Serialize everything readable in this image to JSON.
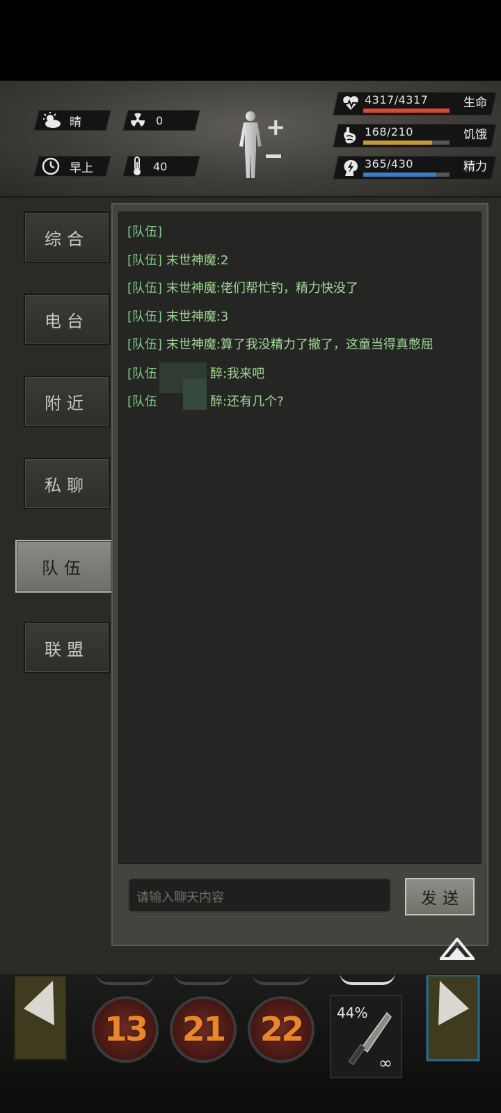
{
  "status": {
    "weather": "晴",
    "radiation": "0",
    "time_of_day": "早上",
    "temperature": "40",
    "health": {
      "value": "4317/4317",
      "label": "生命",
      "fraction": 1.0,
      "color": "#d9493a"
    },
    "hunger": {
      "value": "168/210",
      "label": "饥饿",
      "fraction": 0.8,
      "color": "#c69a3a"
    },
    "energy": {
      "value": "365/430",
      "label": "精力",
      "fraction": 0.849,
      "color": "#3a7fc4"
    }
  },
  "tabs": [
    "综合",
    "电台",
    "附近",
    "私聊",
    "队伍",
    "联盟"
  ],
  "active_tab": "队伍",
  "messages": [
    {
      "channel": "[队伍]",
      "name": "",
      "text": ""
    },
    {
      "channel": "[队伍]",
      "name": "末世神魔",
      "text": ":2"
    },
    {
      "channel": "[队伍]",
      "name": "末世神魔",
      "text": ":佬们帮忙钓，精力快没了"
    },
    {
      "channel": "[队伍]",
      "name": "末世神魔",
      "text": ":3"
    },
    {
      "channel": "[队伍]",
      "name": "末世神魔",
      "text": ":算了我没精力了撤了，这童当得真憋屈"
    },
    {
      "channel": "[队伍",
      "name": "醉",
      "text": ":我来吧"
    },
    {
      "channel": "[队伍",
      "name": "醉",
      "text": ":还有几个?"
    }
  ],
  "input": {
    "placeholder": "请输入聊天内容"
  },
  "send_label": "发送",
  "skills": [
    "13",
    "21",
    "22"
  ],
  "weapon": {
    "durability_pct": "44%",
    "ammo": "∞"
  }
}
